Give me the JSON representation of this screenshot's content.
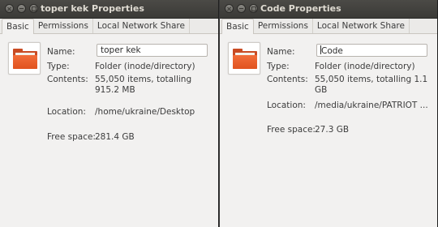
{
  "windows": [
    {
      "title": "toper kek Properties",
      "tabs": [
        "Basic",
        "Permissions",
        "Local Network Share"
      ],
      "name_label": "Name:",
      "name_value": "toper kek",
      "type_label": "Type:",
      "type_value": "Folder (inode/directory)",
      "contents_label": "Contents:",
      "contents_value": "55,050 items, totalling 915.2 MB",
      "location_label": "Location:",
      "location_value": "/home/ukraine/Desktop",
      "free_label": "Free space:",
      "free_value": "281.4 GB"
    },
    {
      "title": "Code Properties",
      "tabs": [
        "Basic",
        "Permissions",
        "Local Network Share"
      ],
      "name_label": "Name:",
      "name_value": "Code",
      "type_label": "Type:",
      "type_value": "Folder (inode/directory)",
      "contents_label": "Contents:",
      "contents_value": "55,050 items, totalling 1.1 GB",
      "location_label": "Location:",
      "location_value": "/media/ukraine/PATRIOT ...",
      "free_label": "Free space:",
      "free_value": "27.3 GB"
    }
  ],
  "icons": {
    "close": "close-icon",
    "minimize": "minimize-icon",
    "maximize": "maximize-icon",
    "folder": "folder-icon"
  },
  "colors": {
    "desktop_bg": "#7a1f3d",
    "titlebar": "#3b3a37",
    "window_bg": "#f2f1f0",
    "folder_orange": "#e1531f"
  }
}
